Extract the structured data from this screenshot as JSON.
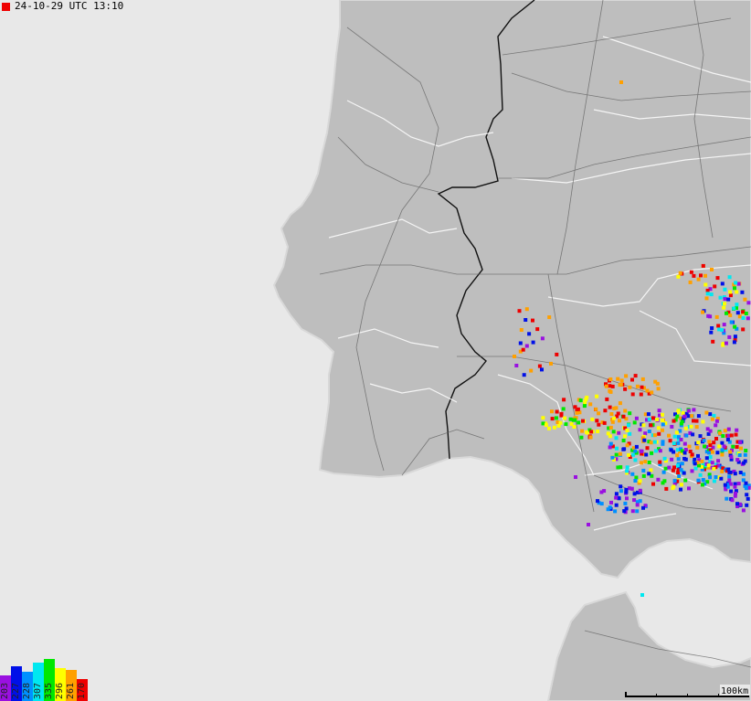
{
  "header": {
    "timestamp": "24-10-29 UTC 13:10"
  },
  "colors": {
    "sea": "#e8e8e8",
    "land": "#bebebe",
    "coast": "#d2d2d2",
    "border": "#111111",
    "road": "#5a5a5a",
    "river": "#ffffff",
    "live_marker": "#ee0000"
  },
  "legend": {
    "items": [
      {
        "label": "203",
        "color": "#9a10e0"
      },
      {
        "label": "227",
        "color": "#0010e8"
      },
      {
        "label": "228",
        "color": "#0090ff"
      },
      {
        "label": "307",
        "color": "#00e8f0"
      },
      {
        "label": "335",
        "color": "#00e800"
      },
      {
        "label": "296",
        "color": "#ffff00"
      },
      {
        "label": "261",
        "color": "#ffa000"
      },
      {
        "label": "170",
        "color": "#ee0000"
      }
    ]
  },
  "scale": {
    "label": "100km"
  }
}
